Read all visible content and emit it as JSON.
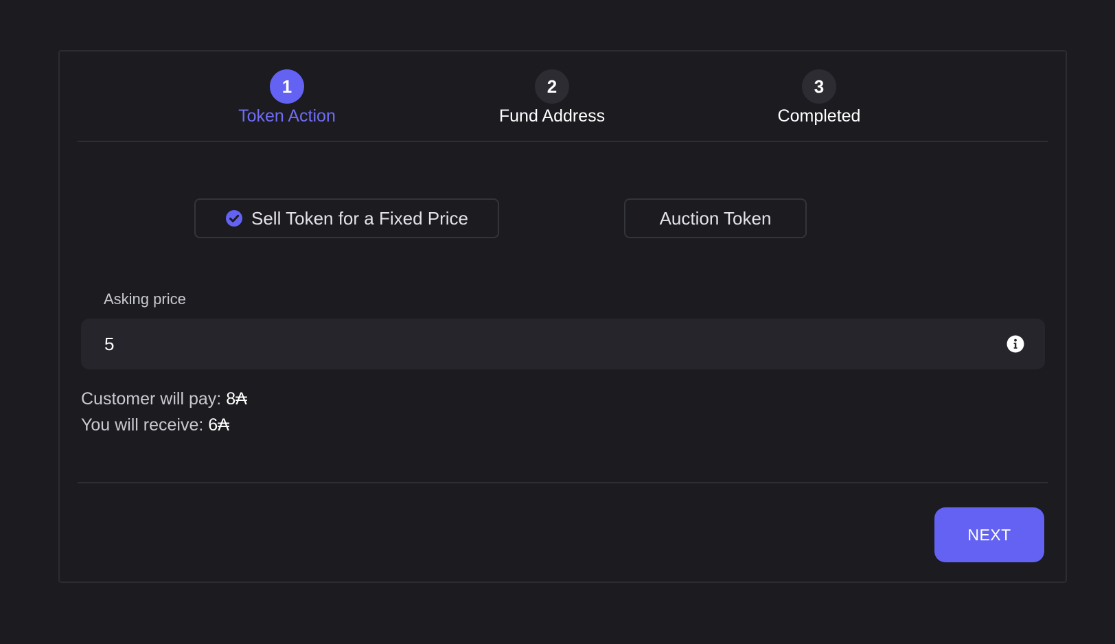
{
  "stepper": {
    "steps": [
      {
        "number": "1",
        "label": "Token Action",
        "active": true
      },
      {
        "number": "2",
        "label": "Fund Address",
        "active": false
      },
      {
        "number": "3",
        "label": "Completed",
        "active": false
      }
    ]
  },
  "options": {
    "fixed_price_label": "Sell Token for a Fixed Price",
    "fixed_price_selected": true,
    "auction_label": "Auction Token",
    "auction_selected": false
  },
  "asking_price": {
    "label": "Asking price",
    "value": "5",
    "info_icon": "info-circle-icon"
  },
  "summary": {
    "customer_pays_label": "Customer will pay:",
    "customer_pays_value": "8₳",
    "you_receive_label": "You will receive:",
    "you_receive_value": "6₳"
  },
  "footer": {
    "next_label": "NEXT"
  },
  "colors": {
    "background": "#1b1b20",
    "accent": "#6462f3",
    "input_bg": "#25252b",
    "border": "#2c2c33"
  }
}
